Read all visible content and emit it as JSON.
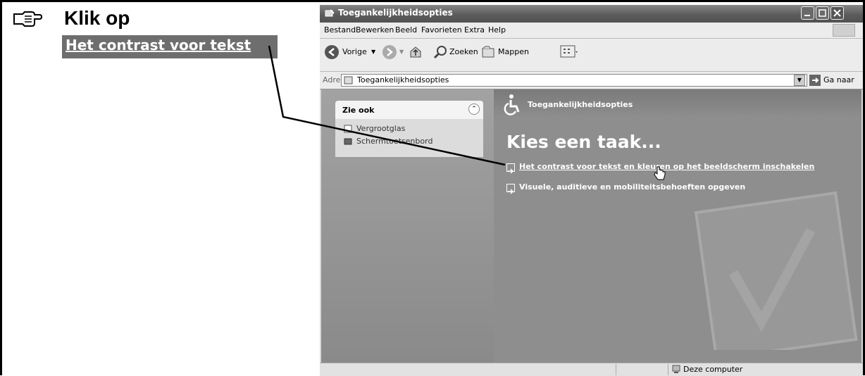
{
  "instruction": {
    "heading": "Klik op",
    "highlight": "Het contrast voor tekst"
  },
  "window": {
    "title": "Toegankelijkheidsopties",
    "menu": [
      "Bestand",
      "Bewerken",
      "Beeld",
      "Favorieten",
      "Extra",
      "Help"
    ],
    "toolbar": {
      "back": "Vorige",
      "search": "Zoeken",
      "folders": "Mappen"
    },
    "address": {
      "label": "Adres",
      "value": "Toegankelijkheidsopties",
      "go": "Ga naar"
    },
    "see_also": {
      "title": "Zie ook",
      "items": [
        "Vergrootglas",
        "Schermtoetsenbord"
      ]
    },
    "panel_title": "Toegankelijkheidsopties",
    "task_heading": "Kies een taak...",
    "tasks": [
      "Het contrast voor tekst en kleuren op het beeldscherm inschakelen",
      "Visuele, auditieve en mobiliteitsbehoeften opgeven"
    ],
    "status": {
      "zone": "Deze computer"
    }
  }
}
